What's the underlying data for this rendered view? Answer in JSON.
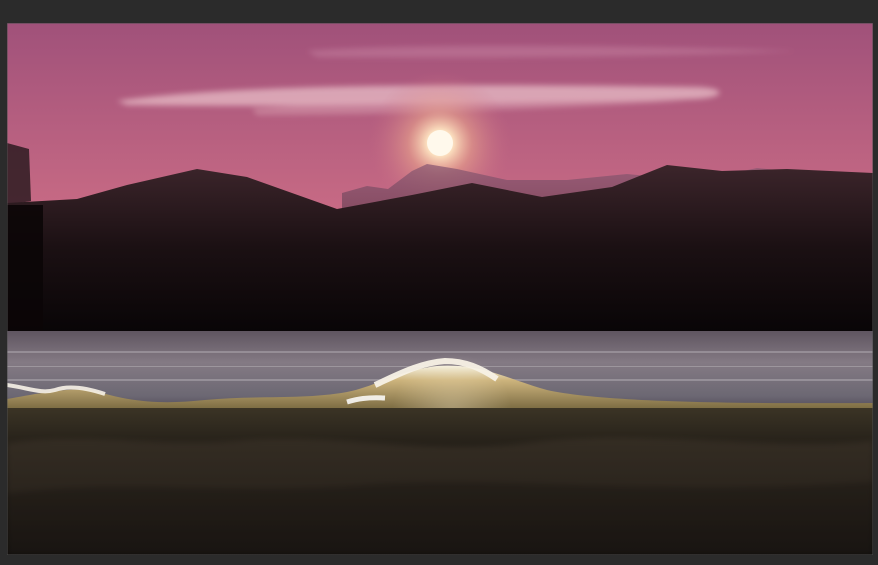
{
  "scene": {
    "subject": "sunset-landscape",
    "colors": {
      "sky_top": "#9d4f7a",
      "sky_mid": "#c96b84",
      "sky_low": "#e48f8a",
      "sun": "#fff4d6",
      "mountain_dark": "#1b0f13",
      "water": "#6d6470",
      "wave_highlight": "#f6f0d8",
      "foreground": "#1d1715",
      "frame_bg": "#2b2b2b"
    }
  }
}
